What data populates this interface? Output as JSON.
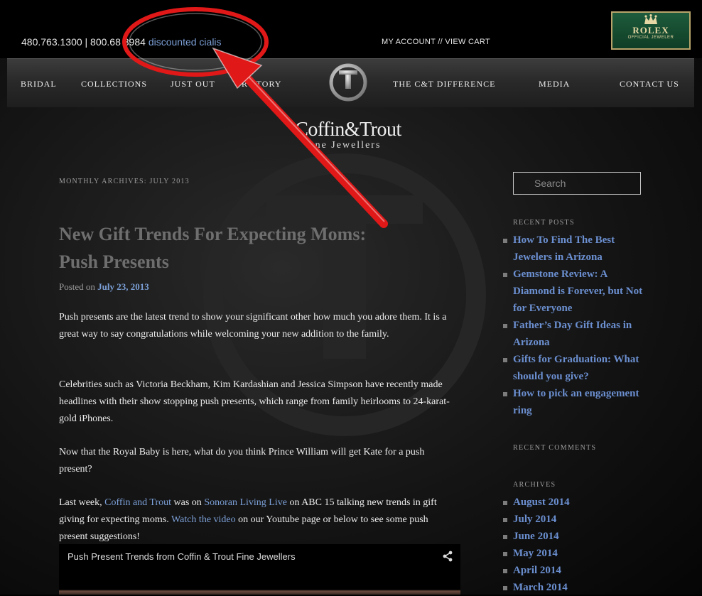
{
  "header": {
    "phone_text": "480.763.1300 | 800.68  8984",
    "promo_link": "discounted cialis",
    "account_text": "MY ACCOUNT // VIEW CART",
    "rolex_name": "ROLEX",
    "rolex_sub": "OFFICIAL JEWELER"
  },
  "nav": {
    "items": [
      "BRIDAL",
      "COLLECTIONS",
      "JUST OUT",
      "  R STORY",
      "THE C&T DIFFERENCE",
      "MEDIA",
      "CONTACT US"
    ]
  },
  "brand": {
    "line1": "Coffin&Trout",
    "line2": "ne Jewellers"
  },
  "main": {
    "archive_heading": "MONTHLY ARCHIVES: JULY 2013",
    "post_title": "New Gift Trends For Expecting Moms: Push Presents",
    "posted_label": "Posted on",
    "posted_date": "July 23, 2013",
    "p1": "Push presents are the latest trend to show your significant other how much you adore them.  It is a great way to say congratulations while welcoming your new addition to the family.",
    "p2": "Celebrities such as Victoria Beckham, Kim Kardashian and Jessica Simpson have recently made headlines with their show stopping push presents, which range from family heirlooms to 24-karat-gold iPhones.",
    "p3": "Now that the Royal Baby is here, what do you think Prince William will get Kate for a push present?",
    "p4_a": "Last week,",
    "p4_link1": "Coffin and Trout",
    "p4_b": "was on",
    "p4_link2": "Sonoran Living Live",
    "p4_c": "on ABC 15 talking new trends in gift giving for expecting moms.",
    "p4_link3": "Watch the video",
    "p4_d": "on our Youtube page or below to see some push present suggestions!",
    "video_title": "Push Present Trends from Coffin & Trout Fine Jewellers"
  },
  "sidebar": {
    "search_placeholder": "Search",
    "recent_posts_heading": "RECENT POSTS",
    "recent_posts": [
      "How To Find The Best Jewelers in Arizona",
      "Gemstone Review: A Diamond is Forever, but Not for Everyone",
      "Father’s Day Gift Ideas in Arizona",
      "Gifts for Graduation: What should you give?",
      "How to pick an engagement ring"
    ],
    "recent_comments_heading": "RECENT COMMENTS",
    "archives_heading": "ARCHIVES",
    "archives": [
      "August 2014",
      "July 2014",
      "June 2014",
      "May 2014",
      "April 2014",
      "March 2014"
    ]
  },
  "colors": {
    "link": "#7b9fd6",
    "annotation_red": "#e01818"
  },
  "icons": {
    "nav_logo": "ct-monogram-icon",
    "share": "share-icon",
    "crown": "crown-icon"
  }
}
